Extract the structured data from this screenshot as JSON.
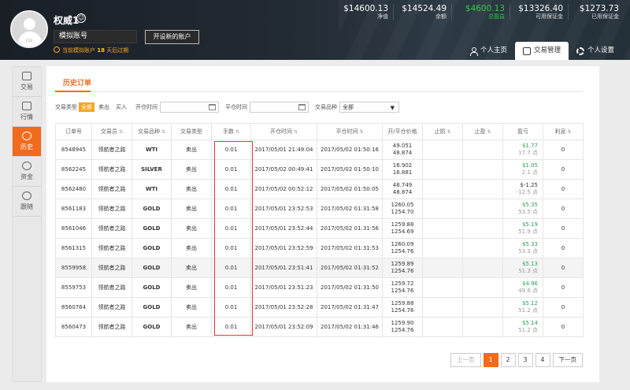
{
  "user": {
    "name": "权威1",
    "avatar_text": "FM",
    "account_type": "模拟账号",
    "open_account_button": "开设新的账户",
    "demo_note_prefix": "当前模拟账户",
    "demo_days": "18",
    "demo_note_suffix": "天后过期"
  },
  "stats": [
    {
      "value": "$14600.13",
      "label": "净值"
    },
    {
      "value": "$14524.49",
      "label": "余额"
    },
    {
      "value": "$4600.13",
      "label": "总盈益"
    },
    {
      "value": "$13326.40",
      "label": "可用保证金"
    },
    {
      "value": "$1273.73",
      "label": "已用保证金"
    }
  ],
  "top_tabs": [
    "个人主页",
    "交易管理",
    "个人设置"
  ],
  "sidebar": [
    {
      "label": "交易"
    },
    {
      "label": "行情"
    },
    {
      "label": "历史"
    },
    {
      "label": "资金"
    },
    {
      "label": "跟随"
    }
  ],
  "sub_tab": "历史订单",
  "filters": {
    "trade_type_label": "交易类型",
    "trade_types": [
      "全部",
      "卖出",
      "买入"
    ],
    "open_time_label": "开仓时间",
    "close_time_label": "平仓时间",
    "symbol_label": "交易品种",
    "symbol_value": "全部"
  },
  "table": {
    "headers": [
      "订单号",
      "交易员",
      "交易品种",
      "交易类型",
      "手数",
      "开仓时间",
      "平仓时间",
      "开/平仓价格",
      "止损",
      "止盈",
      "盈亏",
      "利息"
    ],
    "rows": [
      {
        "order": "8548945",
        "trader": "领航者之路",
        "symbol": "WTI",
        "type": "卖出",
        "lots": "0.01",
        "open": "2017/05/01 21:49:04",
        "close": "2017/05/02 01:50:16",
        "open_price": "49.051",
        "close_price": "48.874",
        "sl": "",
        "tp": "",
        "pl": "$1.77",
        "pts": "17.7 点",
        "sign": "pos",
        "swap": "0"
      },
      {
        "order": "8562245",
        "trader": "领航者之路",
        "symbol": "SILVER",
        "type": "卖出",
        "lots": "0.01",
        "open": "2017/05/02 00:49:41",
        "close": "2017/05/02 01:50:10",
        "open_price": "16.902",
        "close_price": "16.881",
        "sl": "",
        "tp": "",
        "pl": "$1.05",
        "pts": "2.1 点",
        "sign": "pos",
        "swap": "0"
      },
      {
        "order": "8562480",
        "trader": "领航者之路",
        "symbol": "WTI",
        "type": "卖出",
        "lots": "0.01",
        "open": "2017/05/02 00:52:12",
        "close": "2017/05/02 01:50:05",
        "open_price": "48.749",
        "close_price": "48.874",
        "sl": "",
        "tp": "",
        "pl": "$-1.25",
        "pts": "-12.5 点",
        "sign": "neg",
        "swap": "0"
      },
      {
        "order": "8561183",
        "trader": "领航者之路",
        "symbol": "GOLD",
        "type": "卖出",
        "lots": "0.01",
        "open": "2017/05/01 23:52:53",
        "close": "2017/05/02 01:31:58",
        "open_price": "1260.05",
        "close_price": "1254.70",
        "sl": "",
        "tp": "",
        "pl": "$5.35",
        "pts": "53.5 点",
        "sign": "pos",
        "swap": "0"
      },
      {
        "order": "8561046",
        "trader": "领航者之路",
        "symbol": "GOLD",
        "type": "卖出",
        "lots": "0.01",
        "open": "2017/05/01 23:52:44",
        "close": "2017/05/02 01:31:56",
        "open_price": "1259.88",
        "close_price": "1254.69",
        "sl": "",
        "tp": "",
        "pl": "$5.19",
        "pts": "51.9 点",
        "sign": "pos",
        "swap": "0"
      },
      {
        "order": "8561315",
        "trader": "领航者之路",
        "symbol": "GOLD",
        "type": "卖出",
        "lots": "0.01",
        "open": "2017/05/01 23:52:59",
        "close": "2017/05/02 01:31:53",
        "open_price": "1260.09",
        "close_price": "1254.76",
        "sl": "",
        "tp": "",
        "pl": "$5.33",
        "pts": "53.3 点",
        "sign": "pos",
        "swap": "0"
      },
      {
        "order": "8559958",
        "trader": "领航者之路",
        "symbol": "GOLD",
        "type": "卖出",
        "lots": "0.01",
        "open": "2017/05/01 23:51:41",
        "close": "2017/05/02 01:31:52",
        "open_price": "1259.89",
        "close_price": "1254.76",
        "sl": "",
        "tp": "",
        "pl": "$5.13",
        "pts": "51.3 点",
        "sign": "pos",
        "swap": "0"
      },
      {
        "order": "8559753",
        "trader": "领航者之路",
        "symbol": "GOLD",
        "type": "卖出",
        "lots": "0.01",
        "open": "2017/05/01 23:51:23",
        "close": "2017/05/02 01:31:50",
        "open_price": "1259.72",
        "close_price": "1254.76",
        "sl": "",
        "tp": "",
        "pl": "$4.96",
        "pts": "49.6 点",
        "sign": "pos",
        "swap": "0"
      },
      {
        "order": "8560764",
        "trader": "领航者之路",
        "symbol": "GOLD",
        "type": "卖出",
        "lots": "0.01",
        "open": "2017/05/01 23:52:28",
        "close": "2017/05/02 01:31:47",
        "open_price": "1259.88",
        "close_price": "1254.76",
        "sl": "",
        "tp": "",
        "pl": "$5.12",
        "pts": "51.2 点",
        "sign": "pos",
        "swap": "0"
      },
      {
        "order": "8560473",
        "trader": "领航者之路",
        "symbol": "GOLD",
        "type": "卖出",
        "lots": "0.01",
        "open": "2017/05/01 23:52:09",
        "close": "2017/05/02 01:31:46",
        "open_price": "1259.90",
        "close_price": "1254.76",
        "sl": "",
        "tp": "",
        "pl": "$5.14",
        "pts": "51.2 点",
        "sign": "pos",
        "swap": "0"
      }
    ]
  },
  "pagination": {
    "prev": "上一页",
    "pages": [
      "1",
      "2",
      "3",
      "4"
    ],
    "current": "1",
    "next": "下一页"
  },
  "colors": {
    "accent": "#f26b1d",
    "profit": "#2ca05a",
    "highlight_box": "#e23a3a"
  }
}
